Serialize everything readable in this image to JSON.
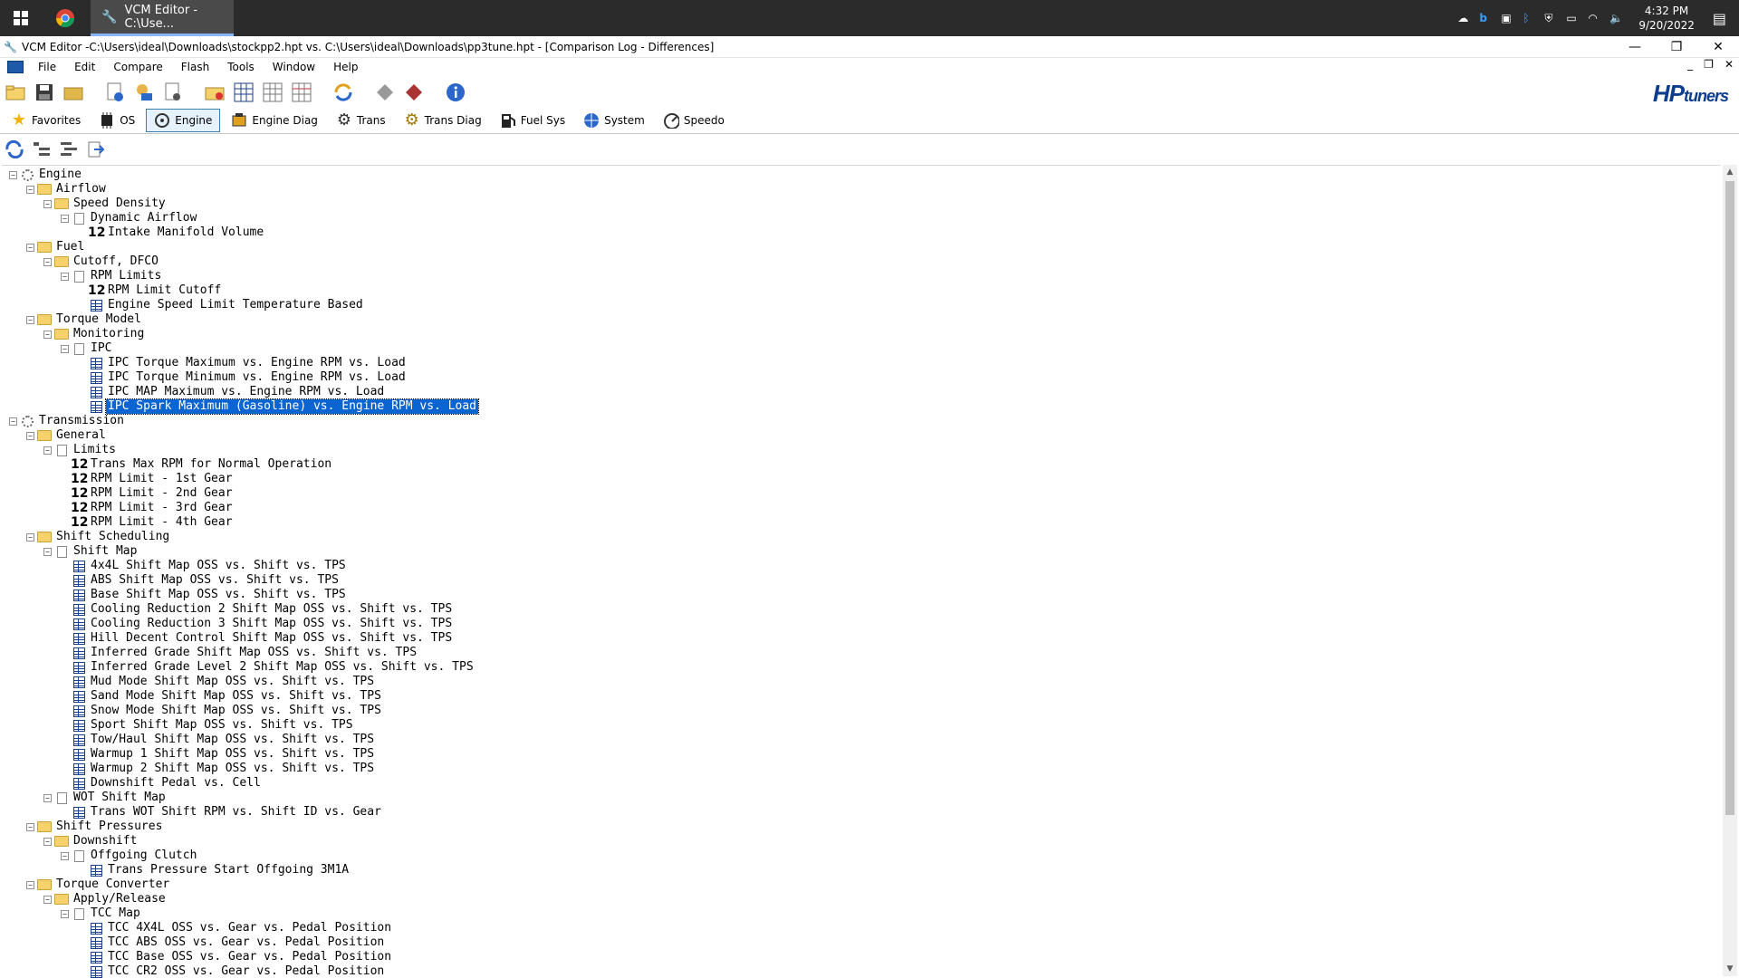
{
  "taskbar": {
    "app_label": "VCM Editor -C:\\Use...",
    "clock_time": "4:32 PM",
    "clock_date": "9/20/2022"
  },
  "window": {
    "title": "VCM Editor -C:\\Users\\ideal\\Downloads\\stockpp2.hpt vs. C:\\Users\\ideal\\Downloads\\pp3tune.hpt - [Comparison Log - Differences]"
  },
  "menu": [
    "File",
    "Edit",
    "Compare",
    "Flash",
    "Tools",
    "Window",
    "Help"
  ],
  "logo": {
    "hp": "HP",
    "tuners": "tuners"
  },
  "categories": [
    {
      "label": "Favorites",
      "icon": "star-icon"
    },
    {
      "label": "OS",
      "icon": "chip-icon"
    },
    {
      "label": "Engine",
      "icon": "engine-icon"
    },
    {
      "label": "Engine Diag",
      "icon": "engine-diag-icon"
    },
    {
      "label": "Trans",
      "icon": "gear-icon"
    },
    {
      "label": "Trans Diag",
      "icon": "gear-diag-icon"
    },
    {
      "label": "Fuel Sys",
      "icon": "fuel-pump-icon"
    },
    {
      "label": "System",
      "icon": "globe-icon"
    },
    {
      "label": "Speedo",
      "icon": "speedometer-icon"
    }
  ],
  "colors": {
    "selection": "#0a64d2",
    "folder": "#f7d26b",
    "logo": "#0d3d8c"
  },
  "tree": [
    {
      "label": "Engine",
      "type": "gear",
      "level": 0,
      "expander": "-"
    },
    {
      "label": "Airflow",
      "type": "folder",
      "level": 1,
      "expander": "-"
    },
    {
      "label": "Speed Density",
      "type": "folder",
      "level": 2,
      "expander": "-"
    },
    {
      "label": "Dynamic Airflow",
      "type": "page",
      "level": 3,
      "expander": "-"
    },
    {
      "label": "Intake Manifold Volume",
      "type": "num",
      "level": 4
    },
    {
      "label": "Fuel",
      "type": "folder",
      "level": 1,
      "expander": "-"
    },
    {
      "label": "Cutoff, DFCO",
      "type": "folder",
      "level": 2,
      "expander": "-"
    },
    {
      "label": "RPM Limits",
      "type": "page",
      "level": 3,
      "expander": "-"
    },
    {
      "label": "RPM Limit Cutoff",
      "type": "num",
      "level": 4
    },
    {
      "label": "Engine Speed Limit Temperature Based",
      "type": "grid",
      "level": 4
    },
    {
      "label": "Torque Model",
      "type": "folder",
      "level": 1,
      "expander": "-"
    },
    {
      "label": "Monitoring",
      "type": "folder",
      "level": 2,
      "expander": "-"
    },
    {
      "label": "IPC",
      "type": "page",
      "level": 3,
      "expander": "-"
    },
    {
      "label": "IPC Torque Maximum vs. Engine RPM vs. Load",
      "type": "grid",
      "level": 4
    },
    {
      "label": "IPC Torque Minimum vs. Engine RPM vs. Load",
      "type": "grid",
      "level": 4
    },
    {
      "label": "IPC MAP Maximum vs. Engine RPM vs. Load",
      "type": "grid",
      "level": 4
    },
    {
      "label": "IPC Spark Maximum (Gasoline) vs. Engine RPM vs. Load",
      "type": "grid",
      "level": 4,
      "selected": true
    },
    {
      "label": "Transmission",
      "type": "gear",
      "level": 0,
      "expander": "-"
    },
    {
      "label": "General",
      "type": "folder",
      "level": 1,
      "expander": "-"
    },
    {
      "label": "Limits",
      "type": "page",
      "level": 2,
      "expander": "-"
    },
    {
      "label": "Trans Max RPM for Normal Operation",
      "type": "num",
      "level": 3
    },
    {
      "label": "RPM Limit - 1st Gear",
      "type": "num",
      "level": 3
    },
    {
      "label": "RPM Limit - 2nd Gear",
      "type": "num",
      "level": 3
    },
    {
      "label": "RPM Limit - 3rd Gear",
      "type": "num",
      "level": 3
    },
    {
      "label": "RPM Limit - 4th Gear",
      "type": "num",
      "level": 3
    },
    {
      "label": "Shift Scheduling",
      "type": "folder",
      "level": 1,
      "expander": "-"
    },
    {
      "label": "Shift Map",
      "type": "page",
      "level": 2,
      "expander": "-"
    },
    {
      "label": "4x4L Shift Map OSS vs. Shift vs. TPS",
      "type": "grid",
      "level": 3
    },
    {
      "label": "ABS Shift Map OSS vs. Shift vs. TPS",
      "type": "grid",
      "level": 3
    },
    {
      "label": "Base Shift Map OSS vs. Shift vs. TPS",
      "type": "grid",
      "level": 3
    },
    {
      "label": "Cooling Reduction 2 Shift Map OSS vs. Shift vs. TPS",
      "type": "grid",
      "level": 3
    },
    {
      "label": "Cooling Reduction 3 Shift Map OSS vs. Shift vs. TPS",
      "type": "grid",
      "level": 3
    },
    {
      "label": "Hill Decent Control Shift Map OSS vs. Shift vs. TPS",
      "type": "grid",
      "level": 3
    },
    {
      "label": "Inferred Grade Shift Map OSS vs. Shift vs. TPS",
      "type": "grid",
      "level": 3
    },
    {
      "label": "Inferred Grade Level 2 Shift Map OSS vs. Shift vs. TPS",
      "type": "grid",
      "level": 3
    },
    {
      "label": "Mud Mode Shift Map OSS vs. Shift vs. TPS",
      "type": "grid",
      "level": 3
    },
    {
      "label": "Sand Mode Shift Map OSS vs. Shift vs. TPS",
      "type": "grid",
      "level": 3
    },
    {
      "label": "Snow Mode Shift Map OSS vs. Shift vs. TPS",
      "type": "grid",
      "level": 3
    },
    {
      "label": "Sport Shift Map OSS vs. Shift vs. TPS",
      "type": "grid",
      "level": 3
    },
    {
      "label": "Tow/Haul Shift Map OSS vs. Shift vs. TPS",
      "type": "grid",
      "level": 3
    },
    {
      "label": "Warmup 1 Shift Map OSS vs. Shift vs. TPS",
      "type": "grid",
      "level": 3
    },
    {
      "label": "Warmup 2 Shift Map OSS vs. Shift vs. TPS",
      "type": "grid",
      "level": 3
    },
    {
      "label": "Downshift Pedal vs. Cell",
      "type": "grid",
      "level": 3
    },
    {
      "label": "WOT Shift Map",
      "type": "page",
      "level": 2,
      "expander": "-"
    },
    {
      "label": "Trans WOT Shift RPM vs. Shift ID vs. Gear",
      "type": "grid",
      "level": 3
    },
    {
      "label": "Shift Pressures",
      "type": "folder",
      "level": 1,
      "expander": "-"
    },
    {
      "label": "Downshift",
      "type": "folder",
      "level": 2,
      "expander": "-"
    },
    {
      "label": "Offgoing Clutch",
      "type": "page",
      "level": 3,
      "expander": "-"
    },
    {
      "label": "Trans Pressure Start Offgoing 3M1A",
      "type": "grid",
      "level": 4
    },
    {
      "label": "Torque Converter",
      "type": "folder",
      "level": 1,
      "expander": "-"
    },
    {
      "label": "Apply/Release",
      "type": "folder",
      "level": 2,
      "expander": "-"
    },
    {
      "label": "TCC Map",
      "type": "page",
      "level": 3,
      "expander": "-"
    },
    {
      "label": "TCC 4X4L OSS vs. Gear vs. Pedal Position",
      "type": "grid",
      "level": 4
    },
    {
      "label": "TCC ABS OSS vs. Gear vs. Pedal Position",
      "type": "grid",
      "level": 4
    },
    {
      "label": "TCC Base OSS vs. Gear vs. Pedal Position",
      "type": "grid",
      "level": 4
    },
    {
      "label": "TCC CR2 OSS vs. Gear vs. Pedal Position",
      "type": "grid",
      "level": 4
    }
  ]
}
